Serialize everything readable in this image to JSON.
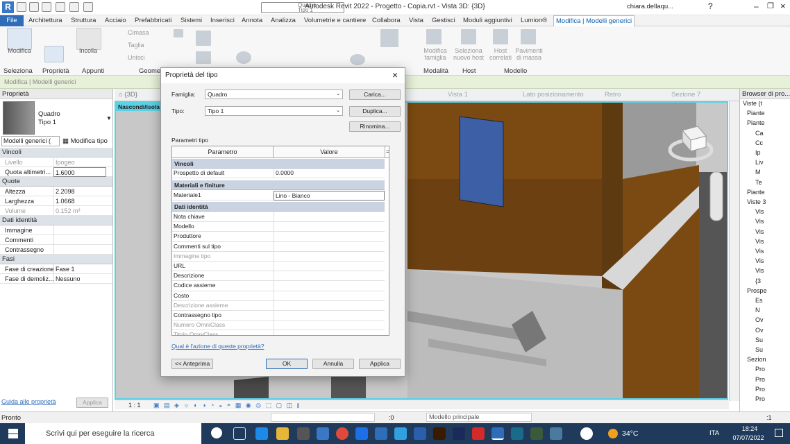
{
  "window": {
    "title": "Autodesk Revit 2022 - Progetto - Copia.rvt - Vista 3D: {3D}",
    "user": "chiara.dellaqu...",
    "type_selector_line1": "Quadro",
    "type_selector_line2": "Tipo 1"
  },
  "ribbon_tabs": [
    "File",
    "Architettura",
    "Struttura",
    "Acciaio",
    "Prefabbricati",
    "Sistemi",
    "Inserisci",
    "Annota",
    "Analizza",
    "Volumetrie e cantiere",
    "Collabora",
    "Vista",
    "Gestisci",
    "Moduli aggiuntivi",
    "Lumion®",
    "Modifica | Modelli generici"
  ],
  "ribbon": {
    "modifica_label": "Modifica",
    "incolla_label": "Incolla",
    "cimasa": "Cimasa",
    "taglia": "Taglia",
    "unisci": "Unisci",
    "groups": [
      "Seleziona",
      "Proprietà",
      "Appunti",
      "Geomet",
      "Modalità",
      "Host",
      "Modello"
    ],
    "tools": [
      "Modifica famiglia",
      "Seleziona nuovo host",
      "Host correlati",
      "Pavimenti di massa"
    ]
  },
  "context_bar": "Modifica | Modelli generici",
  "properties": {
    "header": "Proprietà",
    "type_name": "Quadro",
    "type_sub": "Tipo 1",
    "filter": "Modelli generici (",
    "edit_type": "Modifica tipo",
    "sections": {
      "vincoli": "Vincoli",
      "quote": "Quote",
      "dati": "Dati identità",
      "fasi": "Fasi"
    },
    "rows_vincoli": [
      [
        "Livello",
        "Ipogeo"
      ],
      [
        "Quota altimetri...",
        "1.6000"
      ]
    ],
    "rows_quote": [
      [
        "Altezza",
        "2.2098"
      ],
      [
        "Larghezza",
        "1.0668"
      ],
      [
        "Volume",
        "0.152 m³"
      ]
    ],
    "rows_dati": [
      [
        "Immagine",
        ""
      ],
      [
        "Commenti",
        ""
      ],
      [
        "Contrassegno",
        ""
      ]
    ],
    "rows_fasi": [
      [
        "Fase di creazione",
        "Fase 1"
      ],
      [
        "Fase di demoliz...",
        "Nessuno"
      ]
    ],
    "help_link": "Guida alle proprietà",
    "apply": "Applica"
  },
  "view_tabs": [
    "{3D}",
    "Vista 1",
    "Lato posizionamento",
    "Retro",
    "Sezione 7"
  ],
  "view_label": "Nascondi/isola",
  "scale": "1 : 1",
  "browser": {
    "title": "Browser di pro...",
    "items": [
      "Viste (t",
      "Piante",
      "Piante",
      "Ca",
      "Cc",
      "Ip",
      "Liv",
      "M",
      "Te",
      "Piante",
      "Viste 3",
      "Vis",
      "Vis",
      "Vis",
      "Vis",
      "Vis",
      "Vis",
      "Vis",
      "{3",
      "Prospe",
      "Es",
      "N",
      "Ov",
      "Ov",
      "Su",
      "Su",
      "Sezion",
      "Pro",
      "Pro",
      "Pro",
      "Pro"
    ]
  },
  "status": {
    "left": "Pronto",
    "zero": ":0",
    "model": "Modello principale",
    "filter_count": ":1"
  },
  "taskbar": {
    "search": "Scrivi qui per eseguire la ricerca",
    "temp": "34°C",
    "lang": "ITA",
    "time": "18:24",
    "date": "07/07/2022"
  },
  "dialog": {
    "title": "Proprietà del tipo",
    "famiglia_label": "Famiglia:",
    "famiglia_value": "Quadro",
    "tipo_label": "Tipo:",
    "tipo_value": "Tipo 1",
    "carica": "Carica...",
    "duplica": "Duplica...",
    "rinomina": "Rinomina...",
    "params_label": "Parametri tipo",
    "col_param": "Parametro",
    "col_value": "Valore",
    "col_eq": "=",
    "sec_vincoli": "Vincoli",
    "row_prospetto": [
      "Prospetto di default",
      "0.0000"
    ],
    "sec_materiali": "Materiali e finiture",
    "row_materiale": [
      "Materiale1",
      "Lino - Bianco"
    ],
    "sec_dati": "Dati identità",
    "rows_dati": [
      "Nota chiave",
      "Modello",
      "Produttore",
      "Commenti sul tipo",
      "Immagine tipo",
      "URL",
      "Descrizione",
      "Codice assieme",
      "Costo",
      "Descrizione assieme",
      "Contrassegno tipo",
      "Numero OmniClass",
      "Titolo OmniClass"
    ],
    "help_link": "Qual è l'azione di queste proprietà?",
    "anteprima": "<< Anteprima",
    "ok": "OK",
    "annulla": "Annulla",
    "applica": "Applica"
  },
  "colors": {
    "accent": "#2e6db8",
    "wall_brown": "#7a4a12",
    "wall_gray": "#a9a9a9",
    "selection_cyan": "#5bd1e6",
    "panel_blue": "#3d5fa6"
  }
}
